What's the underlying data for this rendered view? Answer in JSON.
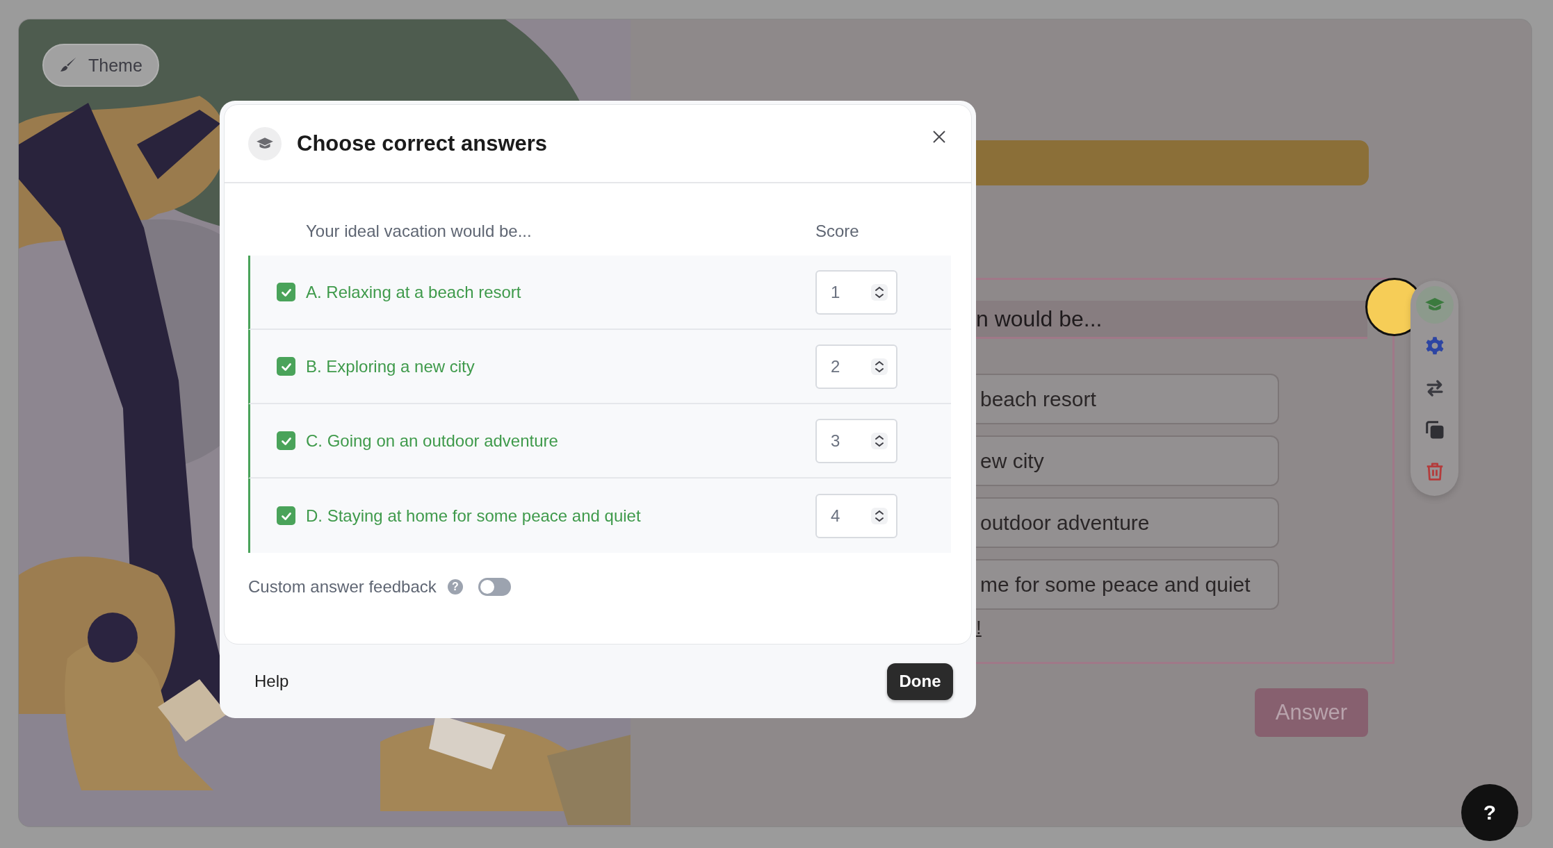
{
  "theme_button": {
    "label": "Theme"
  },
  "background_question": {
    "title_fragment": "n would be...",
    "options": [
      "beach resort",
      "ew city",
      "outdoor adventure",
      "me for some peace and quiet"
    ],
    "link_fragment": "!",
    "answer_button": "Answer"
  },
  "side_toolbar": {
    "items": [
      {
        "kind": "answers",
        "selected": true
      },
      {
        "kind": "settings",
        "selected": false
      },
      {
        "kind": "swap",
        "selected": false
      },
      {
        "kind": "duplicate",
        "selected": false
      },
      {
        "kind": "delete",
        "selected": false
      }
    ]
  },
  "modal": {
    "title": "Choose correct answers",
    "question": "Your ideal vacation would be...",
    "score_heading": "Score",
    "answers": [
      {
        "label": "A. Relaxing at a beach resort",
        "checked": true,
        "score": "1"
      },
      {
        "label": "B. Exploring a new city",
        "checked": true,
        "score": "2"
      },
      {
        "label": "C. Going on an outdoor adventure",
        "checked": true,
        "score": "3"
      },
      {
        "label": "D. Staying at home for some peace and quiet",
        "checked": true,
        "score": "4"
      }
    ],
    "custom_feedback": {
      "label": "Custom answer feedback",
      "help_glyph": "?",
      "on": false
    },
    "help_link": "Help",
    "done_button": "Done"
  },
  "help_bubble": {
    "glyph": "?"
  }
}
